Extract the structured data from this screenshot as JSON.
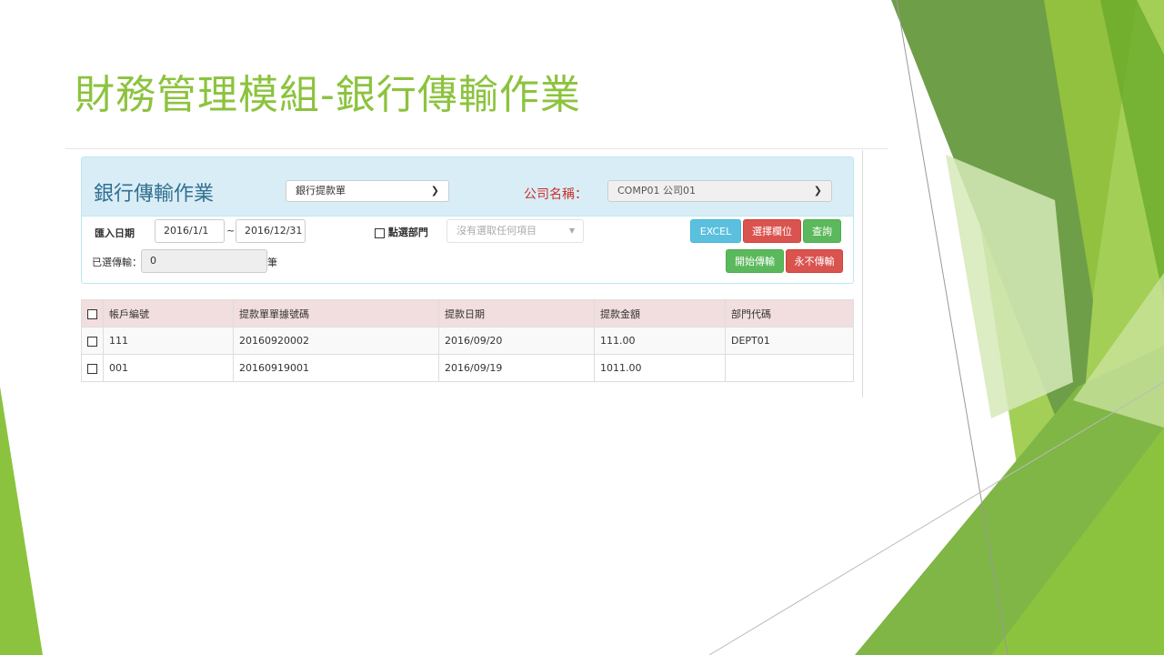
{
  "slide": {
    "title": "財務管理模組-銀行傳輸作業"
  },
  "panel": {
    "title": "銀行傳輸作業",
    "doc_type": "銀行提款單",
    "company_label": "公司名稱：",
    "company_value": "COMP01 公司01"
  },
  "filters": {
    "date_label": "匯入日期",
    "date_from": "2016/1/1",
    "date_sep": "~",
    "date_to": "2016/12/31",
    "dept_checkbox_label": "點選部門",
    "dept_placeholder": "沒有選取任何項目",
    "selected_label": "已選傳輸：",
    "selected_count": "0",
    "selected_unit": "筆"
  },
  "buttons": {
    "excel": "EXCEL",
    "select_columns": "選擇欄位",
    "query": "查詢",
    "start_transfer": "開始傳輸",
    "never_transfer": "永不傳輸"
  },
  "table": {
    "headers": [
      "帳戶編號",
      "提款單單據號碼",
      "提款日期",
      "提款金額",
      "部門代碼"
    ],
    "rows": [
      [
        "111",
        "20160920002",
        "2016/09/20",
        "111.00",
        "DEPT01"
      ],
      [
        "001",
        "20160919001",
        "2016/09/19",
        "1011.00",
        ""
      ]
    ]
  },
  "colors": {
    "title_green": "#8cc33e",
    "panel_bg": "#d9edf7",
    "header_row": "#f2dede",
    "btn_info": "#5bc0de",
    "btn_danger": "#d9534f",
    "btn_success": "#5cb85c"
  }
}
